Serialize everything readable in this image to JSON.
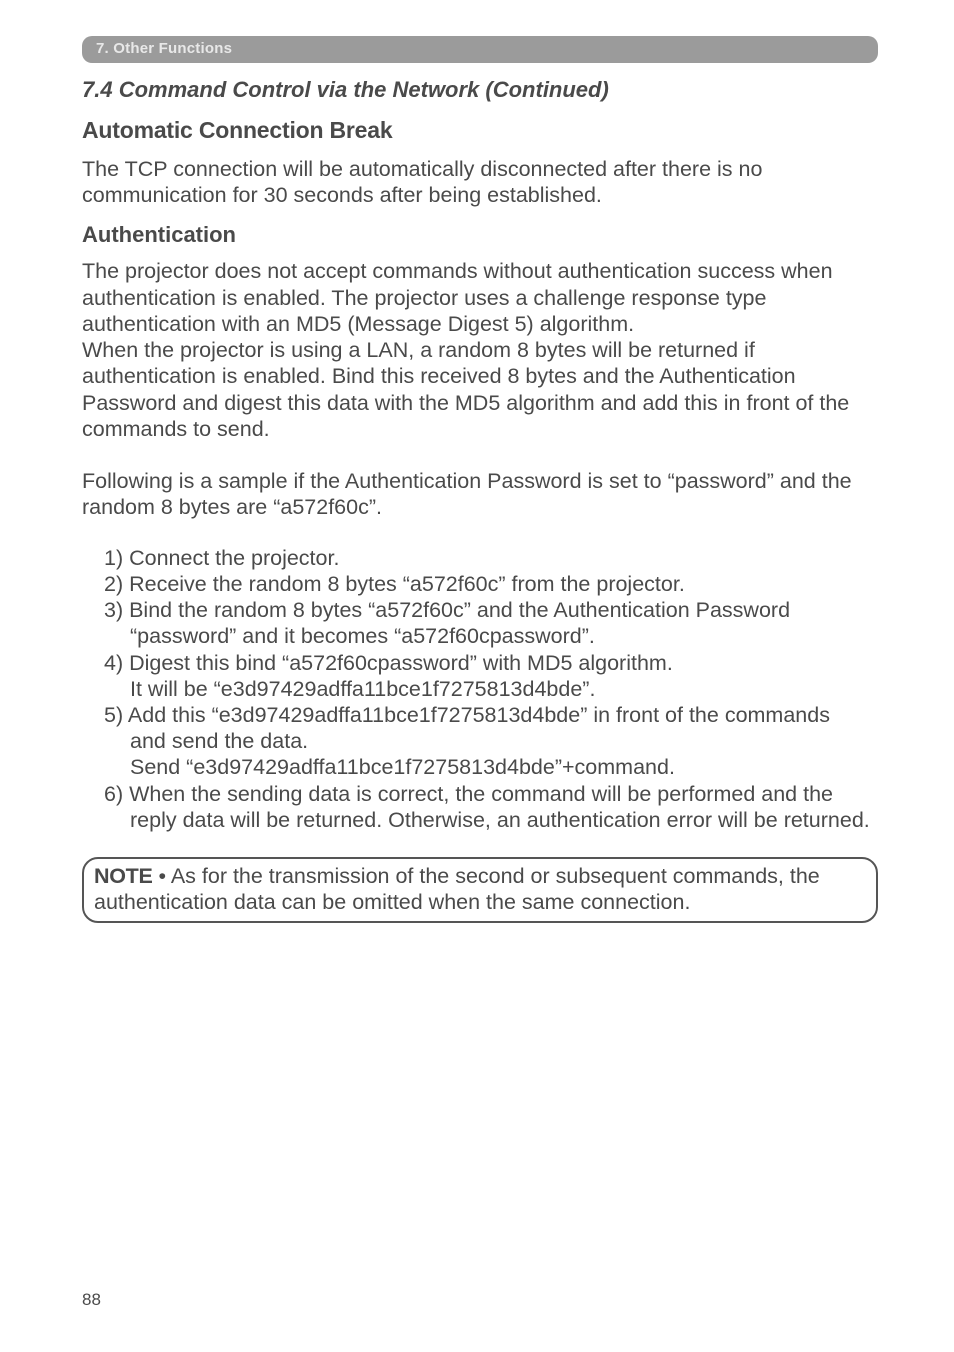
{
  "chapter": "7. Other Functions",
  "sectionTitle": "7.4 Command Control via the Network (Continued)",
  "autoBreak": {
    "heading": "Automatic Connection Break",
    "text": "The TCP connection will be automatically disconnected after there is no communication for 30 seconds after being established."
  },
  "auth": {
    "heading": "Authentication",
    "para1": "The projector does not accept commands without authentication success when authentication is enabled. The projector uses a challenge response type authentication with an MD5 (Message Digest 5) algorithm.",
    "para2": "When the projector is using a LAN, a random 8 bytes will be returned if authentication is enabled. Bind this received 8 bytes and the Authentication Password and digest this data with the MD5 algorithm and add this in front of the commands to send.",
    "para3": "Following is a sample if the Authentication Password is set to “password” and the random 8 bytes are “a572f60c”."
  },
  "steps": {
    "s1": "1) Connect the projector.",
    "s2": "2) Receive the random 8 bytes “a572f60c” from the projector.",
    "s3a": "3) Bind the random 8 bytes “a572f60c” and the Authentication Password",
    "s3b": "“password” and it becomes “a572f60cpassword”.",
    "s4a": "4) Digest this bind “a572f60cpassword” with MD5 algorithm.",
    "s4b": "It will be “e3d97429adffa11bce1f7275813d4bde”.",
    "s5a": "5) Add this “e3d97429adffa11bce1f7275813d4bde” in front of the commands",
    "s5b": "and send the data.",
    "s5c": "Send “e3d97429adffa11bce1f7275813d4bde”+command.",
    "s6a": "6) When the sending data is correct, the command will be performed and the",
    "s6b": "reply data will be returned. Otherwise, an authentication error will be returned."
  },
  "note": {
    "label": "NOTE",
    "text": " • As for the transmission of the second or subsequent commands, the authentication data can be omitted when the same connection."
  },
  "pageNumber": "88"
}
